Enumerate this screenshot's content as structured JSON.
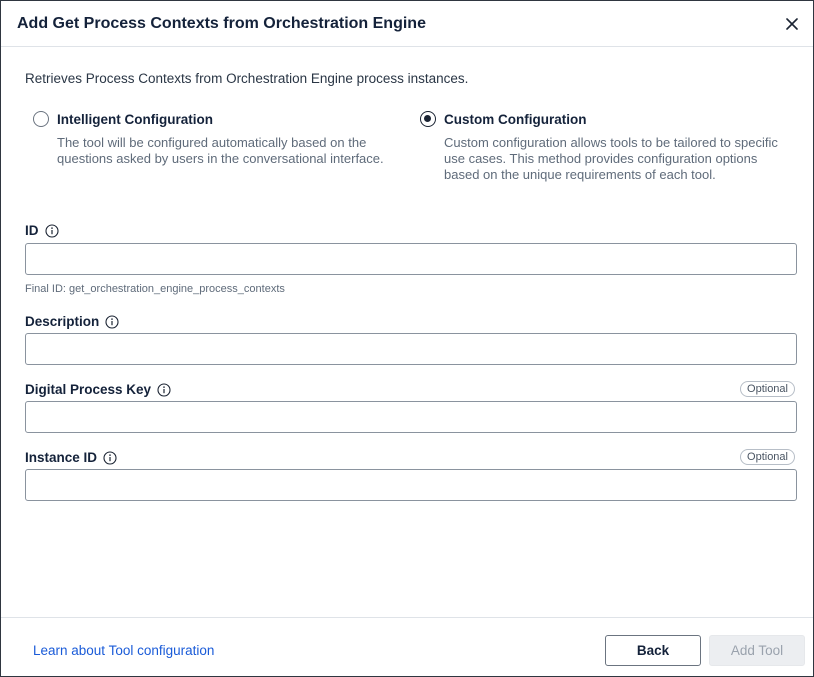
{
  "dialog": {
    "title": "Add Get Process Contexts from Orchestration Engine",
    "description": "Retrieves Process Contexts from Orchestration Engine process instances."
  },
  "config_modes": [
    {
      "label": "Intelligent Configuration",
      "help": "The tool will be configured automatically based on the questions asked by users in the conversational interface.",
      "selected": false
    },
    {
      "label": "Custom Configuration",
      "help": "Custom configuration allows tools to be tailored to specific use cases. This method provides configuration options based on the unique requirements of each tool.",
      "selected": true
    }
  ],
  "fields": {
    "id": {
      "label": "ID",
      "value": "",
      "hint": "Final ID: get_orchestration_engine_process_contexts"
    },
    "description": {
      "label": "Description",
      "value": ""
    },
    "digital_process_key": {
      "label": "Digital Process Key",
      "value": "",
      "badge": "Optional"
    },
    "instance_id": {
      "label": "Instance ID",
      "value": "",
      "badge": "Optional"
    }
  },
  "footer": {
    "learn_link": "Learn about Tool configuration",
    "back_label": "Back",
    "add_label": "Add Tool"
  },
  "colors": {
    "link": "#1a5bd8",
    "title": "#14223a",
    "disabled_bg": "#eceef1"
  },
  "icons": {
    "close": "close-icon",
    "info": "info-icon"
  }
}
